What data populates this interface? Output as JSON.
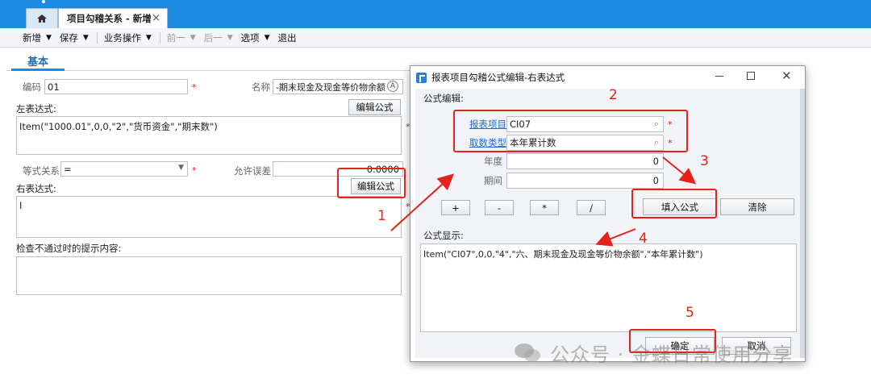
{
  "tabs": {
    "home_icon": "home-icon",
    "doc_tab_label": "项目勾稽关系 - 新增",
    "close_glyph": "×"
  },
  "toolbar": {
    "items": [
      {
        "label": "新增",
        "dropdown": true,
        "enabled": true
      },
      {
        "label": "保存",
        "dropdown": true,
        "enabled": true
      },
      {
        "label": "业务操作",
        "dropdown": true,
        "enabled": true
      },
      {
        "label": "前一",
        "dropdown": true,
        "enabled": false
      },
      {
        "label": "后一",
        "dropdown": true,
        "enabled": false
      },
      {
        "label": "选项",
        "dropdown": true,
        "enabled": true
      },
      {
        "label": "退出",
        "dropdown": false,
        "enabled": true
      }
    ]
  },
  "section_tab": "基本",
  "form": {
    "code_label": "编码",
    "code_value": "01",
    "name_label": "名称",
    "name_value": "-期末现金及现金等价物余额",
    "left_expr_label": "左表达式:",
    "edit_formula_button": "编辑公式",
    "left_expr_value": "Item(\"1000.01\",0,0,\"2\",\"货币资金\",\"期末数\")",
    "equality_label": "等式关系",
    "equality_value": "=",
    "tolerance_label": "允许误差",
    "tolerance_value": "0.0000",
    "right_expr_label": "右表达式:",
    "right_expr_value": "I",
    "fail_msg_label": "检查不通过时的提示内容:",
    "fail_msg_value": "",
    "required_mark": "*"
  },
  "dialog": {
    "title": "报表项目勾稽公式编辑-右表达式",
    "formula_edit_label": "公式编辑:",
    "report_item_label": "报表项目",
    "report_item_value": "CI07",
    "fetch_type_label": "取数类型",
    "fetch_type_value": "本年累计数",
    "year_label": "年度",
    "year_value": "0",
    "period_label": "期间",
    "period_value": "0",
    "ops": [
      "+",
      "-",
      "*",
      "/"
    ],
    "fill_formula_button": "填入公式",
    "clear_button": "清除",
    "formula_display_label": "公式显示:",
    "formula_display_value": "Item(\"CI07\",0,0,\"4\",\"六、期末现金及现金等价物余额\",\"本年累计数\")",
    "ok_button": "确定",
    "cancel_button": "取消"
  },
  "annotations": {
    "numbers": [
      "1",
      "2",
      "3",
      "4",
      "5"
    ],
    "color": "#e8211a"
  },
  "watermark": "公众号 · 金蝶日常使用分享",
  "colors": {
    "tabbar": "#1b8ae0",
    "link": "#1f6fd0",
    "required": "#d9261c"
  }
}
